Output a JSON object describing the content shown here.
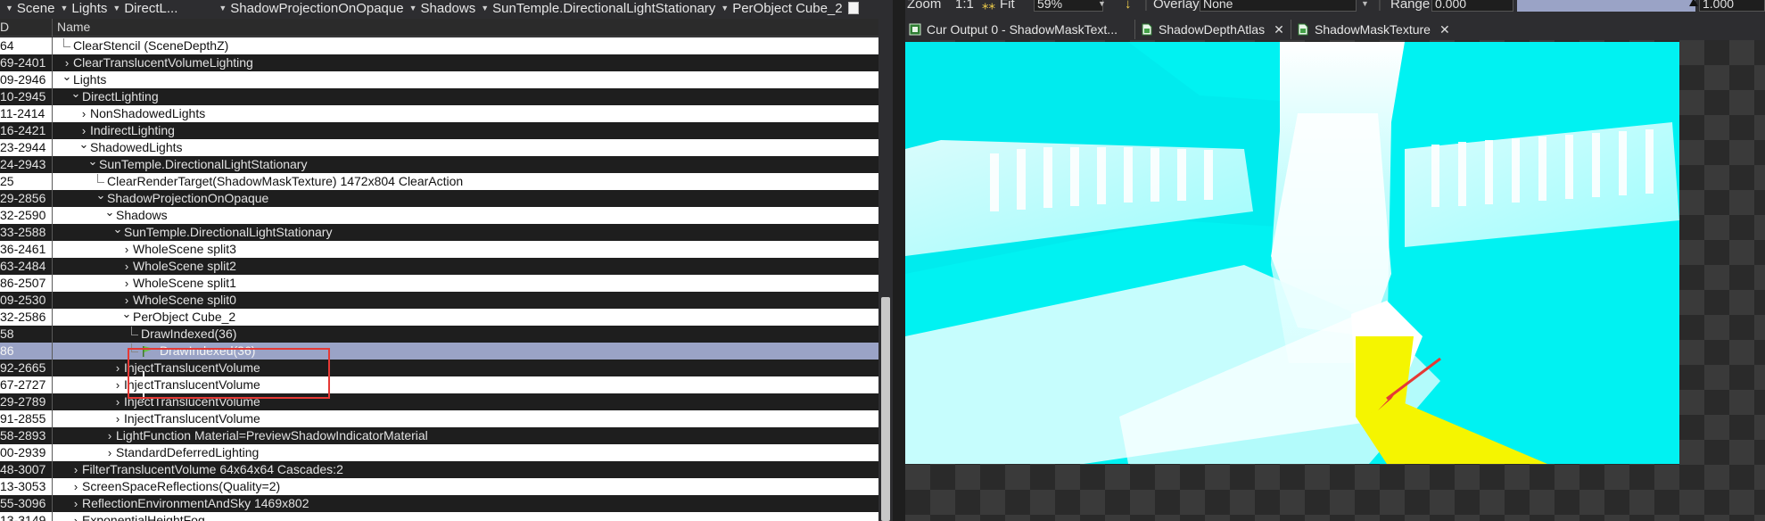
{
  "breadcrumb": [
    {
      "label": "Scene"
    },
    {
      "label": "Lights"
    },
    {
      "label": "DirectL..."
    },
    {
      "label": "ShadowProjectionOnOpaque"
    },
    {
      "label": "Shadows"
    },
    {
      "label": "SunTemple.DirectionalLightStationary"
    },
    {
      "label": "PerObject Cube_2"
    }
  ],
  "columns": {
    "eid": "D",
    "name": "Name"
  },
  "tree": [
    {
      "eid": "64",
      "name": "ClearStencil (SceneDepthZ)",
      "expander": "leaf",
      "level": 0
    },
    {
      "eid": "69-2401",
      "name": "ClearTranslucentVolumeLighting",
      "expander": "›",
      "level": 0
    },
    {
      "eid": "09-2946",
      "name": "Lights",
      "expander": "⌄",
      "level": 0
    },
    {
      "eid": "10-2945",
      "name": "DirectLighting",
      "expander": "⌄",
      "level": 1
    },
    {
      "eid": "11-2414",
      "name": "NonShadowedLights",
      "expander": "›",
      "level": 2
    },
    {
      "eid": "16-2421",
      "name": "IndirectLighting",
      "expander": "›",
      "level": 2
    },
    {
      "eid": "23-2944",
      "name": "ShadowedLights",
      "expander": "⌄",
      "level": 2
    },
    {
      "eid": "24-2943",
      "name": "SunTemple.DirectionalLightStationary",
      "expander": "⌄",
      "level": 3
    },
    {
      "eid": "25",
      "name": "ClearRenderTarget(ShadowMaskTexture) 1472x804 ClearAction",
      "expander": "leaf",
      "level": 4
    },
    {
      "eid": "29-2856",
      "name": "ShadowProjectionOnOpaque",
      "expander": "⌄",
      "level": 4
    },
    {
      "eid": "32-2590",
      "name": "Shadows",
      "expander": "⌄",
      "level": 5
    },
    {
      "eid": "33-2588",
      "name": "SunTemple.DirectionalLightStationary",
      "expander": "⌄",
      "level": 6
    },
    {
      "eid": "36-2461",
      "name": "WholeScene split3",
      "expander": "›",
      "level": 7
    },
    {
      "eid": "63-2484",
      "name": "WholeScene split2",
      "expander": "›",
      "level": 7
    },
    {
      "eid": "86-2507",
      "name": "WholeScene split1",
      "expander": "›",
      "level": 7
    },
    {
      "eid": "09-2530",
      "name": "WholeScene split0",
      "expander": "›",
      "level": 7
    },
    {
      "eid": "32-2586",
      "name": "PerObject Cube_2",
      "expander": "⌄",
      "level": 7
    },
    {
      "eid": "58",
      "name": "DrawIndexed(36)",
      "expander": "leaf",
      "level": 8
    },
    {
      "eid": "86",
      "name": "DrawIndexed(36)",
      "expander": "flag",
      "level": 8,
      "selected": true
    },
    {
      "eid": "92-2665",
      "name": "InjectTranslucentVolume",
      "expander": "›",
      "level": 6
    },
    {
      "eid": "67-2727",
      "name": "InjectTranslucentVolume",
      "expander": "›",
      "level": 6
    },
    {
      "eid": "29-2789",
      "name": "InjectTranslucentVolume",
      "expander": "›",
      "level": 6
    },
    {
      "eid": "91-2855",
      "name": "InjectTranslucentVolume",
      "expander": "›",
      "level": 6
    },
    {
      "eid": "58-2893",
      "name": "LightFunction Material=PreviewShadowIndicatorMaterial",
      "expander": "›",
      "level": 5
    },
    {
      "eid": "00-2939",
      "name": "StandardDeferredLighting",
      "expander": "›",
      "level": 5
    },
    {
      "eid": "48-3007",
      "name": "FilterTranslucentVolume 64x64x64 Cascades:2",
      "expander": "›",
      "level": 1
    },
    {
      "eid": "13-3053",
      "name": "ScreenSpaceReflections(Quality=2)",
      "expander": "›",
      "level": 1
    },
    {
      "eid": "55-3096",
      "name": "ReflectionEnvironmentAndSky 1469x802",
      "expander": "›",
      "level": 1
    },
    {
      "eid": "13-3149",
      "name": "ExponentialHeightFog",
      "expander": "›",
      "level": 1
    }
  ],
  "toolbar": {
    "zoom_label": "Zoom",
    "zoom_ratio": "1:1",
    "fit_label": "Fit",
    "zoom_value": "59%",
    "overlay_label": "Overlay",
    "overlay_value": "None",
    "range_label": "Range",
    "range_min": "0.000",
    "range_max": "1.000"
  },
  "tabs": [
    {
      "label": "Cur Output 0 - ShadowMaskText...",
      "icon": "output-icon",
      "closable": false
    },
    {
      "label": "ShadowDepthAtlas",
      "icon": "texture-icon",
      "closable": true
    },
    {
      "label": "ShadowMaskTexture",
      "icon": "texture-icon",
      "closable": true
    }
  ],
  "colors": {
    "selected_row": "#9aa3c6",
    "highlight_box": "#e53935",
    "shadow_cyan": "#00f0f0",
    "shadow_yellow": "#f5f500"
  }
}
